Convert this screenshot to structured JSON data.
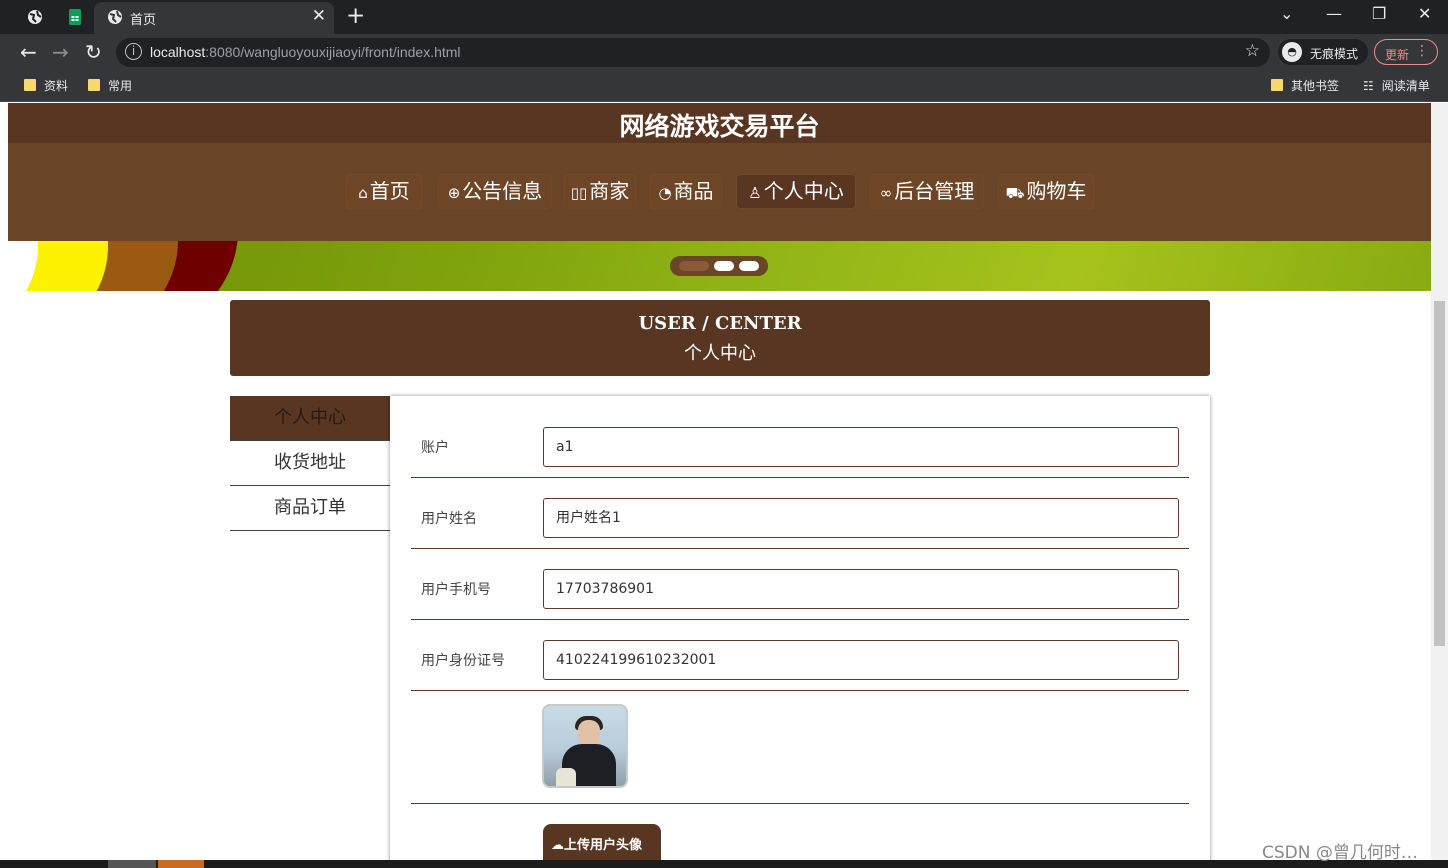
{
  "browser": {
    "tabs": [
      {
        "icon": "globe-icon"
      },
      {
        "icon": "sheets-icon"
      },
      {
        "icon": "globe-icon",
        "title": "首页",
        "active": true
      }
    ],
    "address": {
      "host": "localhost",
      "rest": ":8080/wangluoyouxijiaoyi/front/index.html"
    },
    "incognito_label": "无痕模式",
    "update_label": "更新",
    "bookmarks_left": [
      "资料",
      "常用"
    ],
    "bookmarks_right": [
      "其他书签",
      "阅读清单"
    ]
  },
  "site": {
    "title": "网络游戏交易平台",
    "nav": [
      {
        "icon": "home-icon",
        "glyph": "⌂",
        "label": "首页"
      },
      {
        "icon": "globe-icon",
        "glyph": "⊕",
        "label": "公告信息"
      },
      {
        "icon": "shop-icon",
        "glyph": "▯▯",
        "label": "商家"
      },
      {
        "icon": "gauge-icon",
        "glyph": "◔",
        "label": "商品"
      },
      {
        "icon": "user-icon",
        "glyph": "♙",
        "label": "个人中心",
        "active": true
      },
      {
        "icon": "link-icon",
        "glyph": "∞",
        "label": "后台管理"
      },
      {
        "icon": "cart-icon",
        "glyph": "⛟",
        "label": "购物车"
      }
    ],
    "carousel": {
      "slide_count": 3,
      "active_index": 0
    }
  },
  "user_center": {
    "heading_en": "USER / CENTER",
    "heading_cn": "个人中心",
    "menu": [
      {
        "label": "个人中心",
        "active": true
      },
      {
        "label": "收货地址"
      },
      {
        "label": "商品订单"
      }
    ],
    "fields": [
      {
        "label": "账户",
        "value": "a1"
      },
      {
        "label": "用户姓名",
        "value": "用户姓名1"
      },
      {
        "label": "用户手机号",
        "value": "17703786901"
      },
      {
        "label": "用户身份证号",
        "value": "410224199610232001"
      }
    ],
    "upload_label": "上传用户头像",
    "upload_icon": "cloud-upload-icon"
  },
  "watermark": "CSDN @曾几何时…",
  "colors": {
    "primary": "#583622",
    "nav": "#6a4527",
    "accent_border": "#5c3a24"
  }
}
